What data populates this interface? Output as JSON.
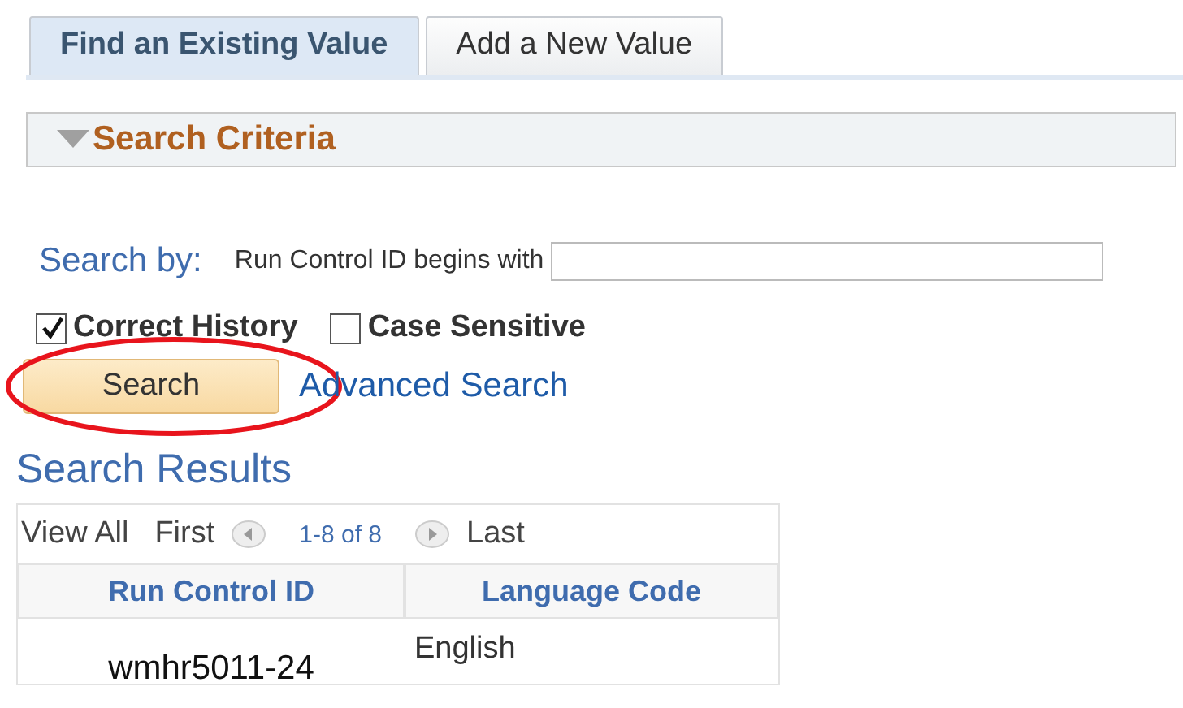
{
  "tabs": [
    {
      "label": "Find an Existing Value",
      "selected": true
    },
    {
      "label": "Add a New Value",
      "selected": false
    }
  ],
  "search_criteria": {
    "title": "Search Criteria",
    "expanded": true
  },
  "search_by": {
    "label": "Search by:",
    "field_label": "Run Control ID begins with"
  },
  "options": [
    {
      "label": "Correct History",
      "checked": true
    },
    {
      "label": "Case Sensitive",
      "checked": false
    }
  ],
  "search_button": {
    "label": "Search",
    "circled": true
  },
  "advanced_search": "Advanced Search",
  "results": {
    "title": "Search Results",
    "view_all": "View All",
    "first": "First",
    "range": "1-8 of 8",
    "last": "Last",
    "columns": [
      "Run Control ID",
      "Language Code"
    ],
    "rows": [
      [
        "wmhr5011-24",
        "English"
      ]
    ]
  }
}
